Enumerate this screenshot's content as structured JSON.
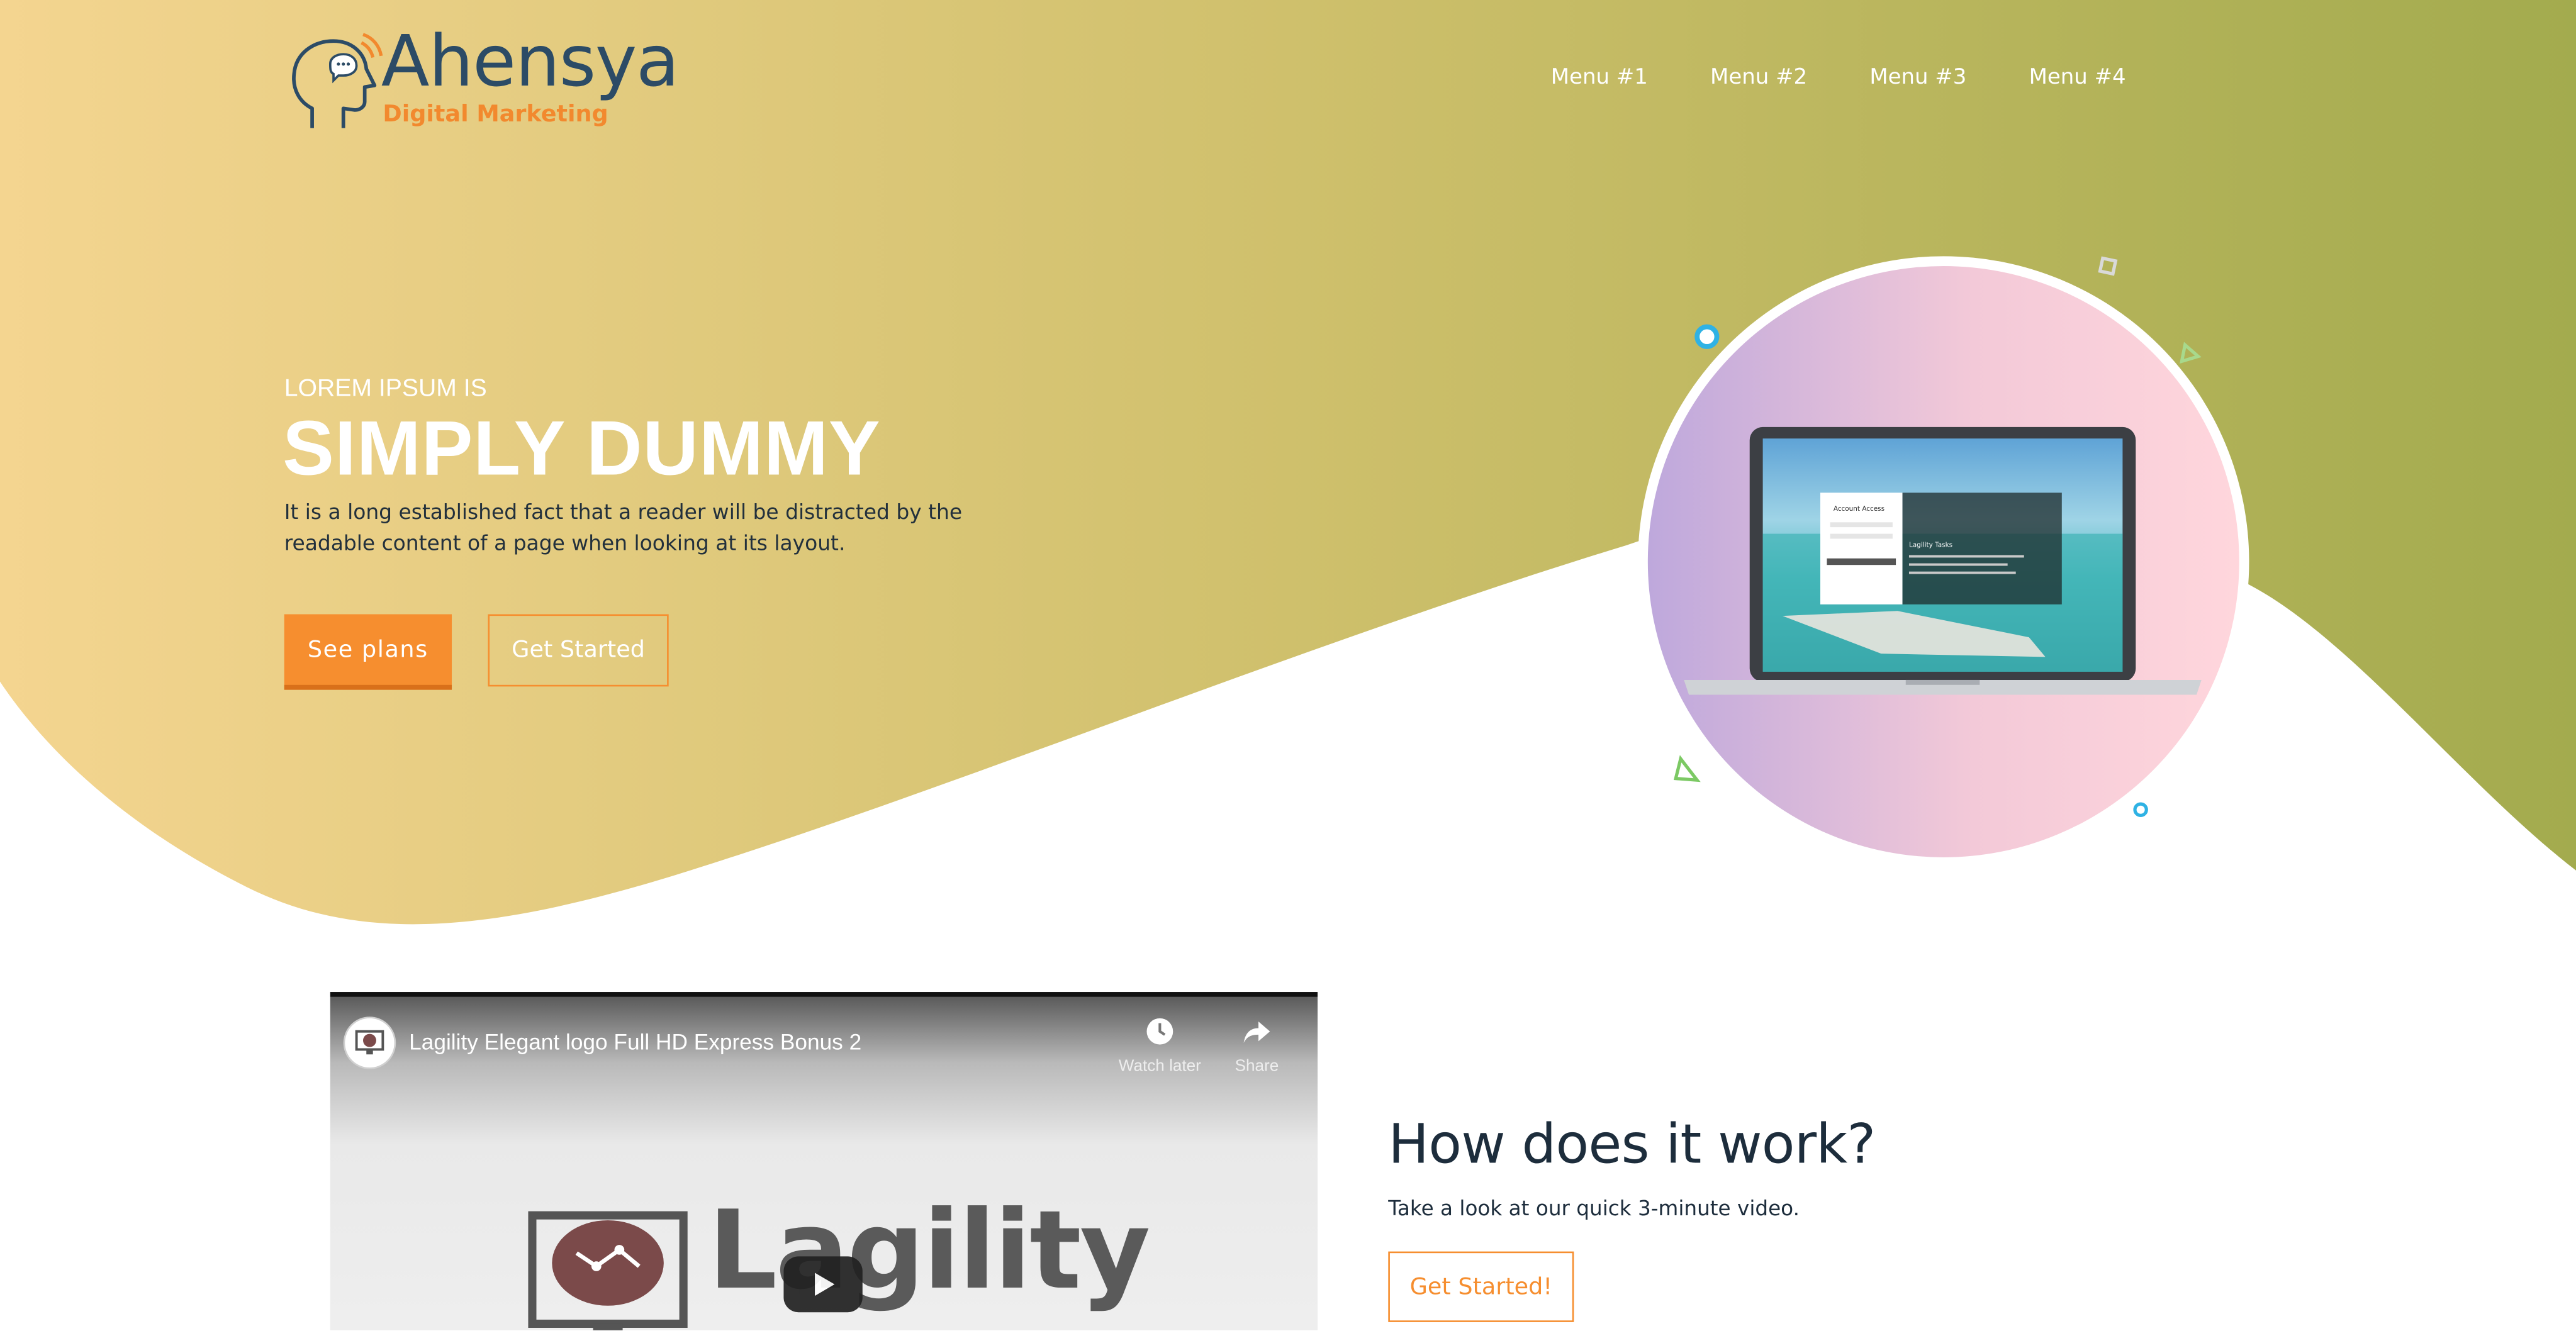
{
  "brand": {
    "name": "Ahensya",
    "tagline": "Digital Marketing"
  },
  "nav": {
    "items": [
      {
        "label": "Menu #1"
      },
      {
        "label": "Menu #2"
      },
      {
        "label": "Menu #3"
      },
      {
        "label": "Menu #4"
      }
    ]
  },
  "hero": {
    "eyebrow": "LOREM IPSUM IS",
    "headline": "SIMPLY DUMMY",
    "description": "It is a long established fact that a reader will be distracted by the readable content of a page when looking at its layout.",
    "primary_button": "See plans",
    "secondary_button": "Get Started"
  },
  "illustration": {
    "login_card_title": "Account Access",
    "side_panel_title": "Lagility Tasks"
  },
  "video": {
    "title": "Lagility Elegant logo Full HD Express Bonus 2",
    "watch_later": "Watch later",
    "share": "Share",
    "brand_word": "Lagility"
  },
  "how": {
    "title": "How does it work?",
    "subtitle": "Take a look at our quick 3-minute video.",
    "button": "Get Started!"
  },
  "colors": {
    "accent": "#f68e2f",
    "hero_gradient_start": "#f4d590",
    "hero_gradient_end": "#a3ab4e",
    "navy": "#2c4b66"
  }
}
